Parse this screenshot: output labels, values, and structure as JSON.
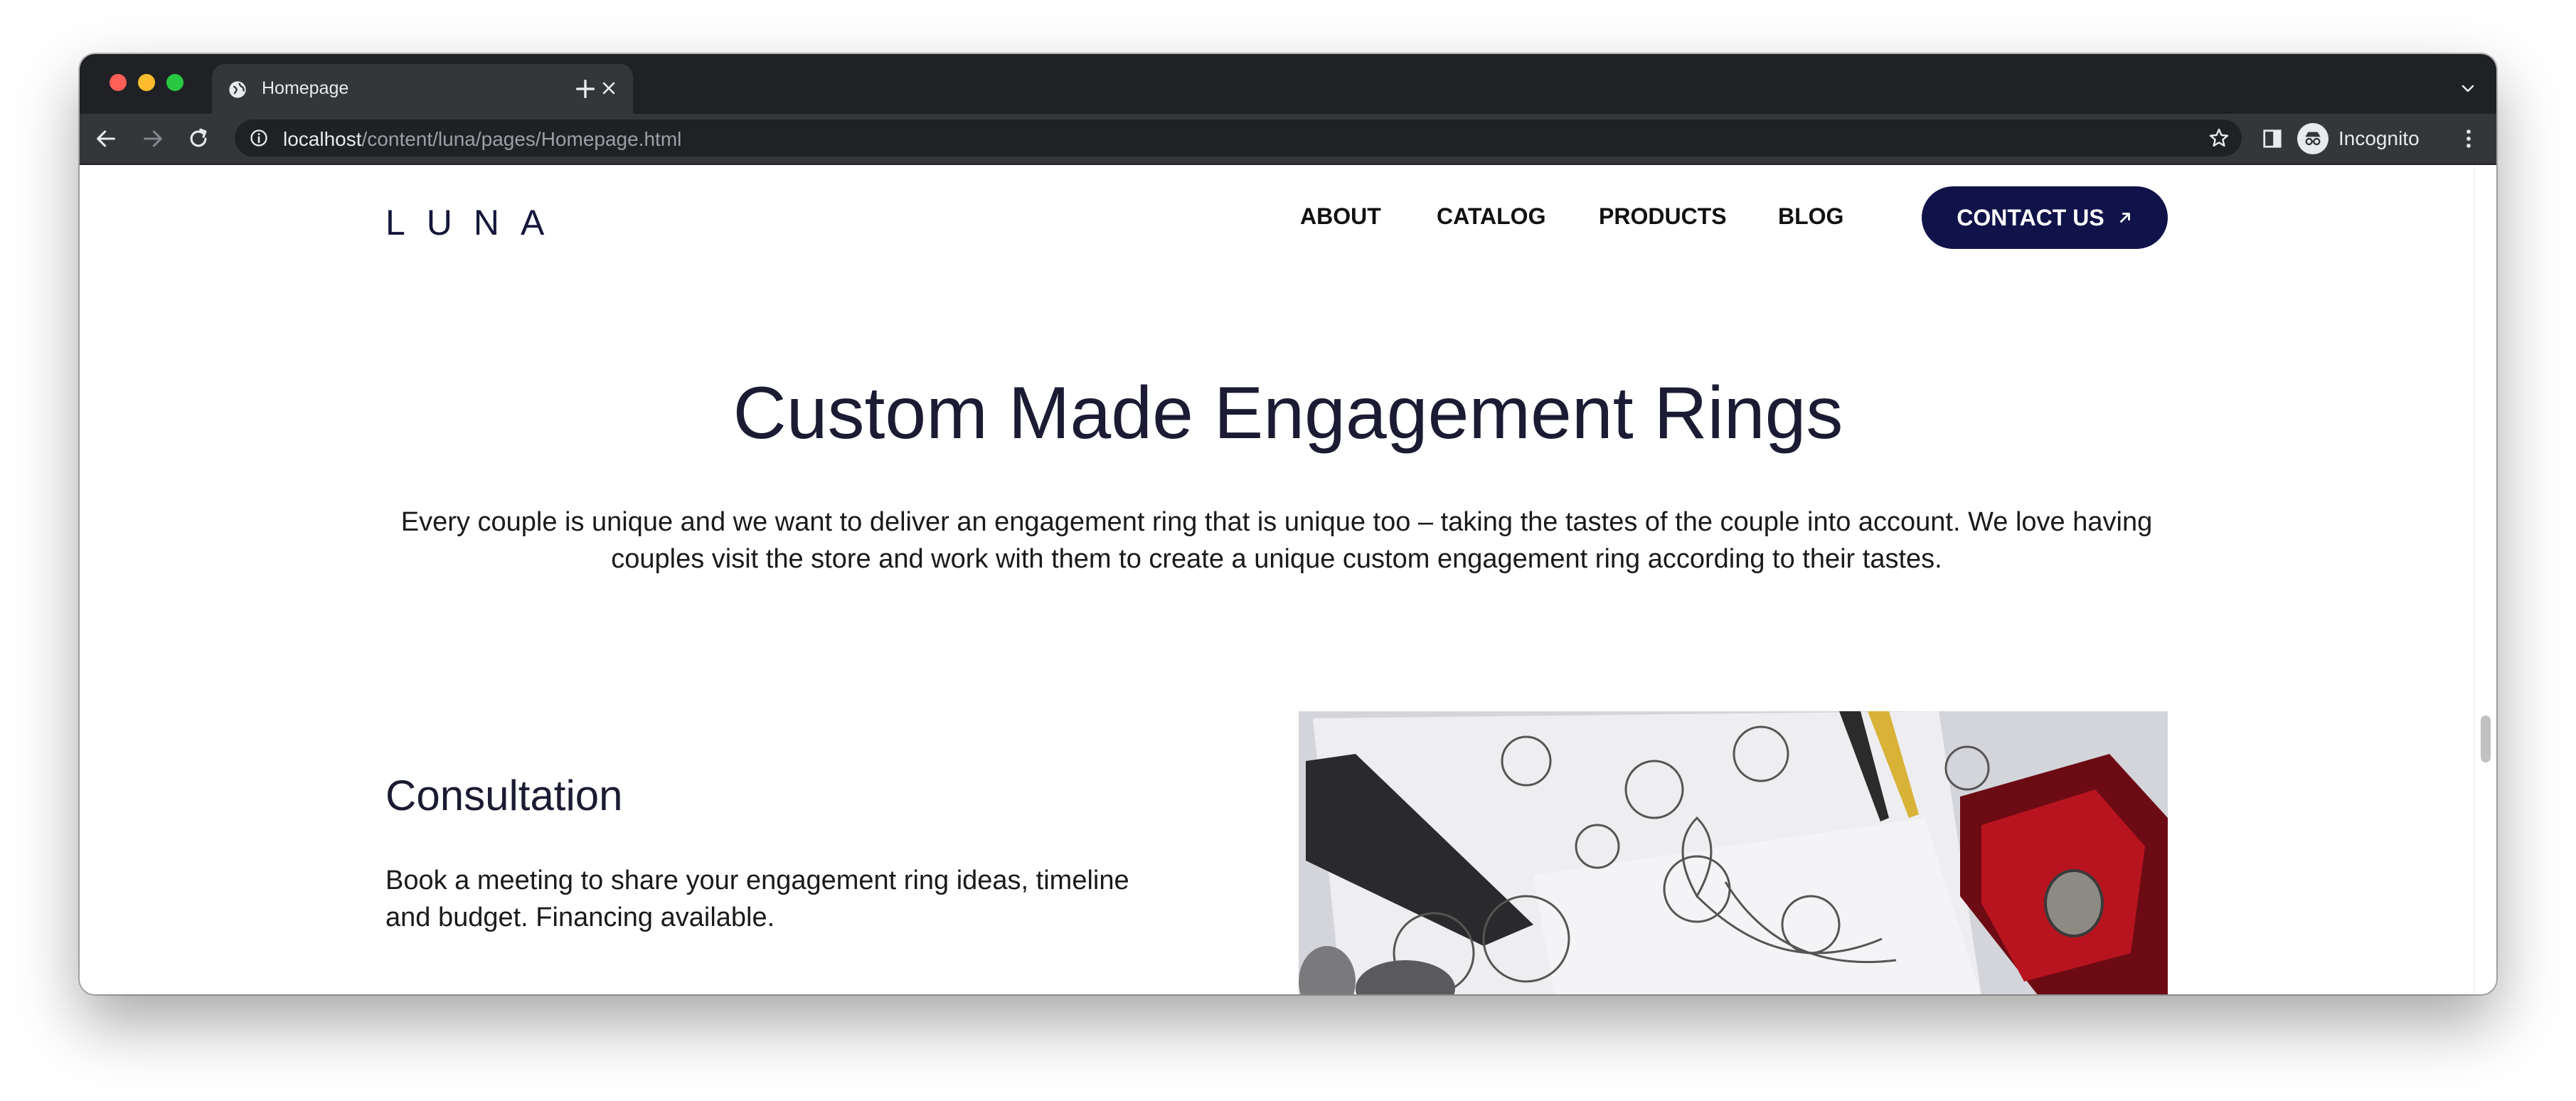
{
  "browser": {
    "tab_title": "Homepage",
    "url_host": "localhost",
    "url_path": "/content/luna/pages/Homepage.html",
    "profile_label": "Incognito"
  },
  "site": {
    "logo": "LUNA",
    "nav": {
      "about": "ABOUT",
      "catalog": "CATALOG",
      "products": "PRODUCTS",
      "blog": "BLOG"
    },
    "contact_label": "CONTACT US"
  },
  "hero": {
    "title": "Custom Made Engagement Rings",
    "text": "Every couple is unique and we want to deliver an engagement ring that is unique too – taking the tastes of the couple into account. We love having couples visit the store and work with them to create a unique custom engagement ring according to their tastes."
  },
  "consultation": {
    "title": "Consultation",
    "text": "Book a meeting to share your engagement ring ideas, timeline and budget. Financing available."
  },
  "colors": {
    "brand_navy": "#10134a",
    "heading": "#1b1c33",
    "chrome_dark": "#1f2124",
    "chrome_toolbar": "#35363a"
  },
  "icons": {
    "tab_favicon": "globe-icon",
    "tab_close": "close-icon",
    "new_tab": "plus-icon",
    "back": "back-arrow-icon",
    "forward": "forward-arrow-icon",
    "reload": "reload-icon",
    "site_info": "info-icon",
    "bookmark": "star-icon",
    "side_panel": "side-panel-icon",
    "incognito": "incognito-icon",
    "menu": "kebab-menu-icon",
    "contact_arrow": "arrow-up-right-icon"
  }
}
